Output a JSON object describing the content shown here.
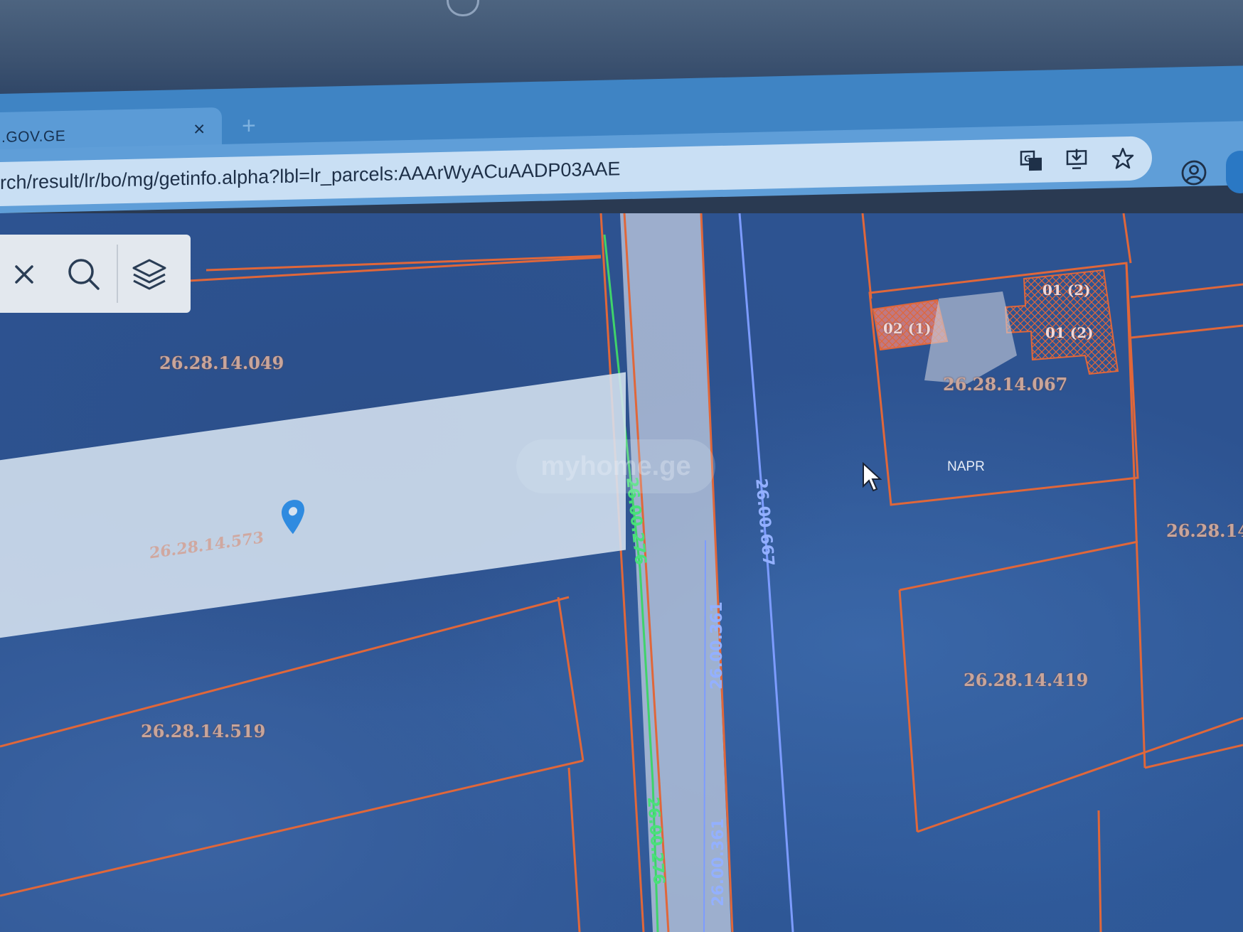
{
  "browser": {
    "tab_title": ".GOV.GE",
    "tab_close": "×",
    "new_tab": "+",
    "url": "rch/result/lr/bo/mg/getinfo.alpha?lbl=lr_parcels:AAArWyACuAADP03AAE",
    "toolbar_icons": [
      "translate-icon",
      "install-app-icon",
      "star-bookmark-icon",
      "profile-icon"
    ]
  },
  "map_controls": {
    "icons": [
      "close-icon",
      "search-icon",
      "layers-icon"
    ]
  },
  "popup": {
    "parcel_code": "26.28.14.573"
  },
  "watermark": "myhome.ge",
  "parcels": [
    {
      "id": "p049",
      "code": "26.28.14.049"
    },
    {
      "id": "p067",
      "code": "26.28.14.067"
    },
    {
      "id": "p519",
      "code": "26.28.14.519"
    },
    {
      "id": "p419",
      "code": "26.28.14.419"
    },
    {
      "id": "pedge",
      "code": "26.28.14"
    }
  ],
  "buildings": {
    "b02": "02 (1)",
    "b01a": "01 (2)",
    "b01b": "01 (2)",
    "owner": "NAPR"
  },
  "roads": {
    "green": "26.00.276",
    "green2": "26.00.276",
    "blue": "26.00.667",
    "road361a": "26.00.361",
    "road361b": "26.00.361"
  },
  "colors": {
    "parcel_border": "#e0673a",
    "road_green": "#3fd36a",
    "road_blue": "#7d9cff",
    "pin": "#2f8be0"
  }
}
